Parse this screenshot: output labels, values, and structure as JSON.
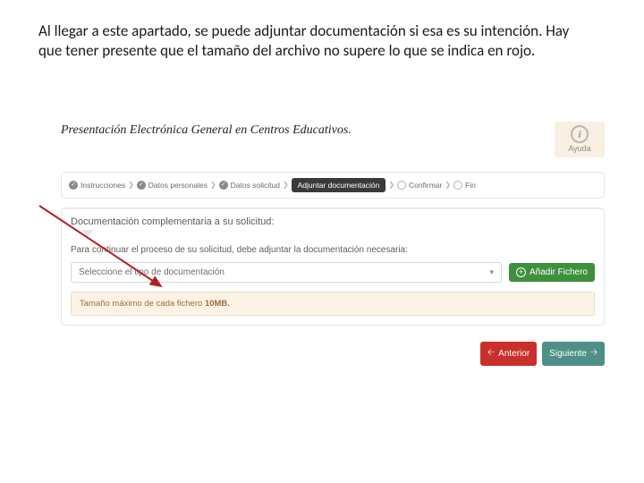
{
  "caption": "Al llegar a este apartado, se puede adjuntar documentación si esa es su intención. Hay que tener presente que el tamaño del archivo no supere lo que se indica en rojo.",
  "page": {
    "title": "Presentación Electrónica General en Centros Educativos.",
    "help_label": "Ayuda"
  },
  "wizard": {
    "steps": [
      {
        "label": "Instrucciones"
      },
      {
        "label": "Datos personales"
      },
      {
        "label": "Datos solicitud"
      },
      {
        "label": "Adjuntar documentación",
        "active": true
      },
      {
        "label": "Confirmar"
      },
      {
        "label": "Fin"
      }
    ]
  },
  "section": {
    "heading": "Documentación complementaria a su solicitud:",
    "instruction": "Para continuar el proceso de su solicitud, debe adjuntar la documentación necesaria:",
    "select_placeholder": "Seleccione el tipo de documentación",
    "add_button": "Añadir Fichero",
    "warn_prefix": "Tamaño máximo de cada fichero ",
    "warn_size": "10MB."
  },
  "nav": {
    "prev": "Anterior",
    "next": "Siguiente"
  },
  "colors": {
    "accent_green": "#3e8f3e",
    "accent_red": "#c9302c",
    "accent_teal": "#4f8f88",
    "warn_bg": "#fbf3e6",
    "warn_text": "#a76a3c"
  }
}
